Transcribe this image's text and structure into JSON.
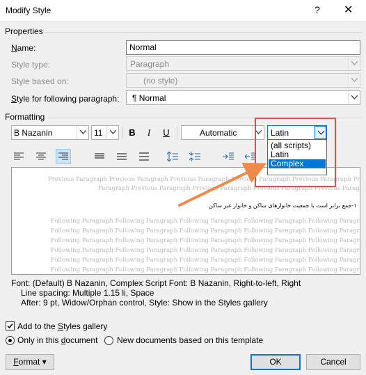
{
  "window": {
    "title": "Modify Style",
    "help": "?",
    "close": "✕"
  },
  "properties": {
    "group_label": "Properties",
    "name_label": "Name:",
    "name_value": "Normal",
    "style_type_label": "Style type:",
    "style_type_value": "Paragraph",
    "based_on_label": "Style based on:",
    "based_on_value": "(no style)",
    "following_label": "Style for following paragraph:",
    "following_value": "¶  Normal"
  },
  "formatting": {
    "group_label": "Formatting",
    "font": "B Nazanin",
    "size": "11",
    "bold": "B",
    "italic": "I",
    "underline": "U",
    "color": "Automatic",
    "script": "Latin",
    "script_options": [
      "(all scripts)",
      "Latin",
      "Complex"
    ],
    "script_selected": "Complex"
  },
  "preview": {
    "previous_1": "Previous Paragraph Previous Paragraph Previous Paragraph Previous Paragraph Previous Paragraph Previous Paragraph",
    "previous_2": "Paragraph Previous Paragraph Previous Paragraph Previous Paragraph Previous Paragraph Previous Paragraph",
    "sample": "۱-جمع برابر است با جمعیت خانوارهای ساکن و خانوار غیر ساکن",
    "following": "Following Paragraph Following Paragraph Following Paragraph Following Paragraph Following Paragraph"
  },
  "description": {
    "line1": "Font: (Default) B Nazanin, Complex Script Font: B Nazanin, Right-to-left, Right",
    "line2": "Line spacing:  Multiple 1.15 li, Space",
    "line3": "After:  9 pt, Widow/Orphan control, Style: Show in the Styles gallery"
  },
  "options": {
    "add_gallery": "Add to the Styles gallery",
    "only_doc": "Only in this document",
    "new_docs": "New documents based on this template"
  },
  "buttons": {
    "format": "Format",
    "ok": "OK",
    "cancel": "Cancel"
  }
}
